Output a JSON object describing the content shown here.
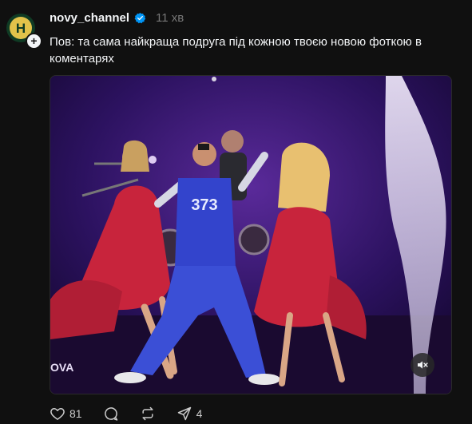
{
  "post": {
    "username": "novy_channel",
    "timestamp": "11 хв",
    "text": "Пов: та сама найкраща подруга під кожною твоєю новою фоткою в коментарях",
    "avatar_letter": "H",
    "media_caption": "OVA"
  },
  "actions": {
    "like_count": "81",
    "share_count": "4"
  },
  "icons": {
    "verified": "verified-icon",
    "like": "heart-icon",
    "comment": "comment-icon",
    "repost": "repost-icon",
    "share": "send-icon",
    "mute": "volume-muted-icon",
    "follow": "plus-icon"
  },
  "colors": {
    "background": "#101010",
    "verified_blue": "#0095f6",
    "muted_text": "#777777",
    "stage_purple": "#2a0f55",
    "dress_red": "#c8243c",
    "costume_blue": "#3344cc"
  }
}
